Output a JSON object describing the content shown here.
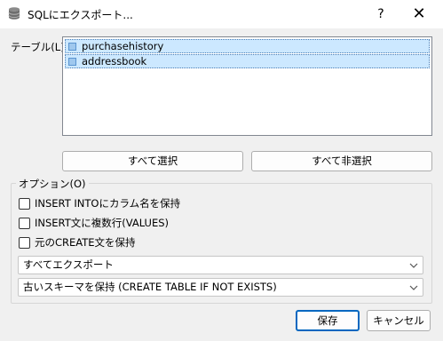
{
  "window": {
    "title": "SQLにエクスポート...",
    "help_label": "?",
    "close_label": "✕",
    "icon": "database-icon"
  },
  "tables": {
    "label": "テーブル(L)",
    "items": [
      {
        "name": "purchasehistory",
        "selected": true
      },
      {
        "name": "addressbook",
        "selected": true
      }
    ],
    "select_all_label": "すべて選択",
    "deselect_all_label": "すべて非選択"
  },
  "options": {
    "legend": "オプション(O)",
    "checkboxes": [
      {
        "label": "INSERT INTOにカラム名を保持",
        "checked": false
      },
      {
        "label": "INSERT文に複数行(VALUES)",
        "checked": false
      },
      {
        "label": "元のCREATE文を保持",
        "checked": false
      }
    ],
    "export_mode": {
      "value": "すべてエクスポート"
    },
    "schema_mode": {
      "value": "古いスキーマを保持 (CREATE TABLE IF NOT EXISTS)"
    }
  },
  "actions": {
    "save_label": "保存",
    "cancel_label": "キャンセル"
  },
  "colors": {
    "selection_bg": "#cce8ff",
    "default_button_border": "#0067c0"
  }
}
